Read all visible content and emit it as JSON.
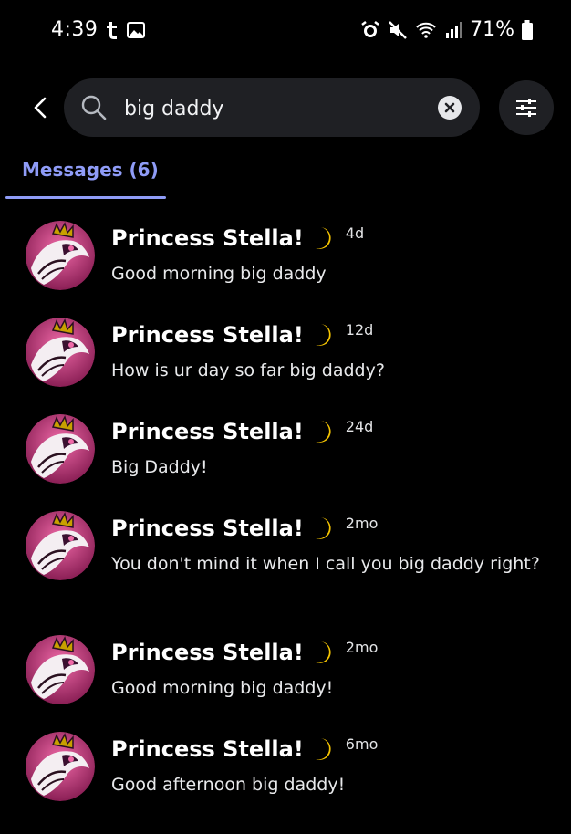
{
  "status_bar": {
    "time": "4:39",
    "battery": "71%",
    "left_icons": [
      "tumblr-icon",
      "gallery-icon"
    ],
    "right_icons": [
      "alarm-icon",
      "mute-icon",
      "wifi-icon",
      "signal-icon",
      "battery-icon"
    ]
  },
  "search": {
    "query": "big daddy",
    "placeholder": "Search"
  },
  "tabs": {
    "messages_label": "Messages (6)"
  },
  "colors": {
    "accent": "#8f9cf7",
    "background": "#000000",
    "search_bg": "#1f2024",
    "moon": "#f5c400"
  },
  "results": [
    {
      "author": "Princess Stella!",
      "timestamp": "4d",
      "message": "Good morning big daddy"
    },
    {
      "author": "Princess Stella!",
      "timestamp": "12d",
      "message": "How is ur day so far big daddy?"
    },
    {
      "author": "Princess Stella!",
      "timestamp": "24d",
      "message": "Big Daddy!"
    },
    {
      "author": "Princess Stella!",
      "timestamp": "2mo",
      "message": "You don't mind it when I call you big daddy right?"
    },
    {
      "author": "Princess Stella!",
      "timestamp": "2mo",
      "message": "Good morning big daddy!"
    },
    {
      "author": "Princess Stella!",
      "timestamp": "6mo",
      "message": "Good afternoon big daddy!"
    }
  ]
}
